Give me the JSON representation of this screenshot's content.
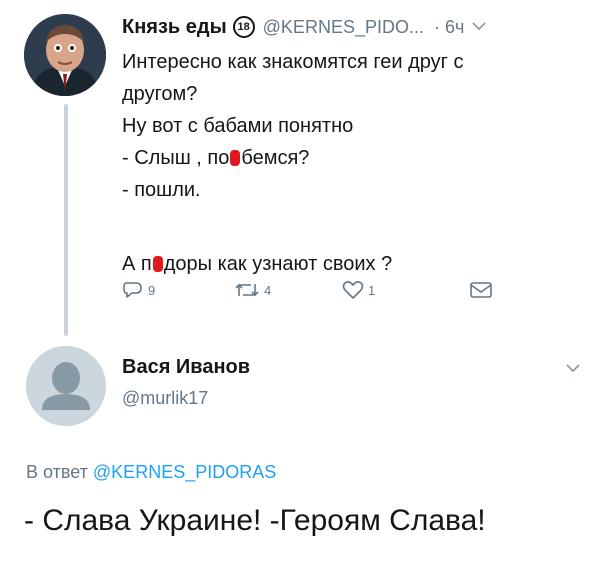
{
  "tweet1": {
    "author_name": "Князь еды",
    "age_badge": "18",
    "handle": "@KERNES_PIDO...",
    "time": "· 6ч",
    "lines": {
      "l1": "Интересно как знакомятся геи друг с",
      "l2": "другом?",
      "l3": "Ну вот с бабами понятно",
      "l4a": "- Слыш , по",
      "l4b": "бемся?",
      "l5": "- пошли.",
      "l6a": "А п",
      "l6b": "доры как узнают своих ?"
    },
    "actions": {
      "reply_count": "9",
      "retweet_count": "4",
      "like_count": "1"
    }
  },
  "tweet2": {
    "author_name": "Вася Иванов",
    "handle": "@murlik17",
    "reply_prefix": "В ответ",
    "reply_to_handle": "@KERNES_PIDORAS",
    "text": "- Слава Украине!  -Героям Слава!"
  },
  "colors": {
    "text": "#14171a",
    "secondary": "#657786",
    "link": "#1da1f2",
    "redaction": "#e0191e",
    "thread_line": "#c9d2da"
  },
  "icons": [
    "reply-icon",
    "retweet-icon",
    "like-icon",
    "message-icon",
    "chevron-down-icon",
    "default-avatar-icon"
  ]
}
